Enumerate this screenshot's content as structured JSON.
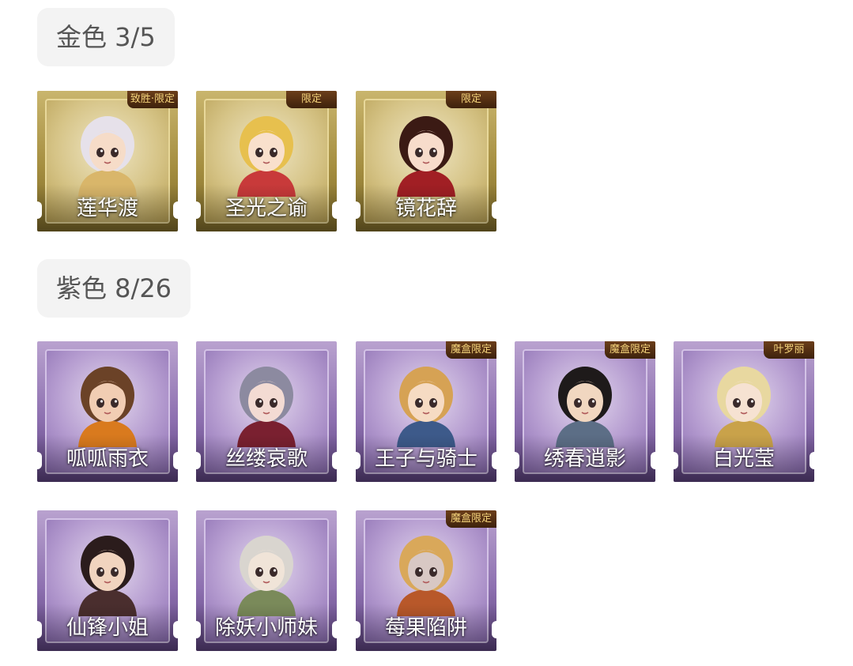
{
  "sections": {
    "gold": {
      "label": "金色 3/5",
      "accent": "#b49a4a",
      "cards": [
        {
          "name": "莲华渡",
          "badge": "致胜·限定",
          "hair": "#e6e1ea",
          "skin": "#f6dcc8",
          "cloth": "#d9b66a",
          "icon": "portrait-icon"
        },
        {
          "name": "圣光之谕",
          "badge": "限定",
          "hair": "#e7c04e",
          "skin": "#f9e0cc",
          "cloth": "#c83a3a",
          "icon": "portrait-icon"
        },
        {
          "name": "镜花辞",
          "badge": "限定",
          "hair": "#3b1a14",
          "skin": "#f7dccb",
          "cloth": "#a11f24",
          "icon": "portrait-icon"
        }
      ]
    },
    "purple": {
      "label": "紫色 8/26",
      "accent": "#8a6cb0",
      "cards": [
        {
          "name": "呱呱雨衣",
          "badge": "",
          "hair": "#6b4227",
          "skin": "#f1cdb3",
          "cloth": "#d97a1e",
          "icon": "portrait-icon"
        },
        {
          "name": "丝缕哀歌",
          "badge": "",
          "hair": "#8c8aa0",
          "skin": "#f3dbd3",
          "cloth": "#7a2030",
          "icon": "portrait-icon"
        },
        {
          "name": "王子与骑士",
          "badge": "魔盒限定",
          "hair": "#d6a254",
          "skin": "#f6dbc3",
          "cloth": "#3d5a8a",
          "icon": "portrait-icon"
        },
        {
          "name": "绣春逍影",
          "badge": "魔盒限定",
          "hair": "#1e1a1a",
          "skin": "#f1d7c0",
          "cloth": "#5c6e86",
          "icon": "portrait-icon"
        },
        {
          "name": "白光莹",
          "badge": "叶罗丽",
          "hair": "#e8d8a0",
          "skin": "#f6e2d2",
          "cloth": "#c9a24a",
          "icon": "portrait-icon"
        },
        {
          "name": "仙锋小姐",
          "badge": "",
          "hair": "#2b1c1c",
          "skin": "#f1d4bf",
          "cloth": "#4a2e2e",
          "icon": "portrait-icon"
        },
        {
          "name": "除妖小师妹",
          "badge": "",
          "hair": "#d9d5cf",
          "skin": "#f0e4d8",
          "cloth": "#7a8a5a",
          "icon": "portrait-icon"
        },
        {
          "name": "莓果陷阱",
          "badge": "魔盒限定",
          "hair": "#d9a85a",
          "skin": "#d8c8c4",
          "cloth": "#b8582a",
          "icon": "portrait-icon"
        }
      ]
    }
  }
}
